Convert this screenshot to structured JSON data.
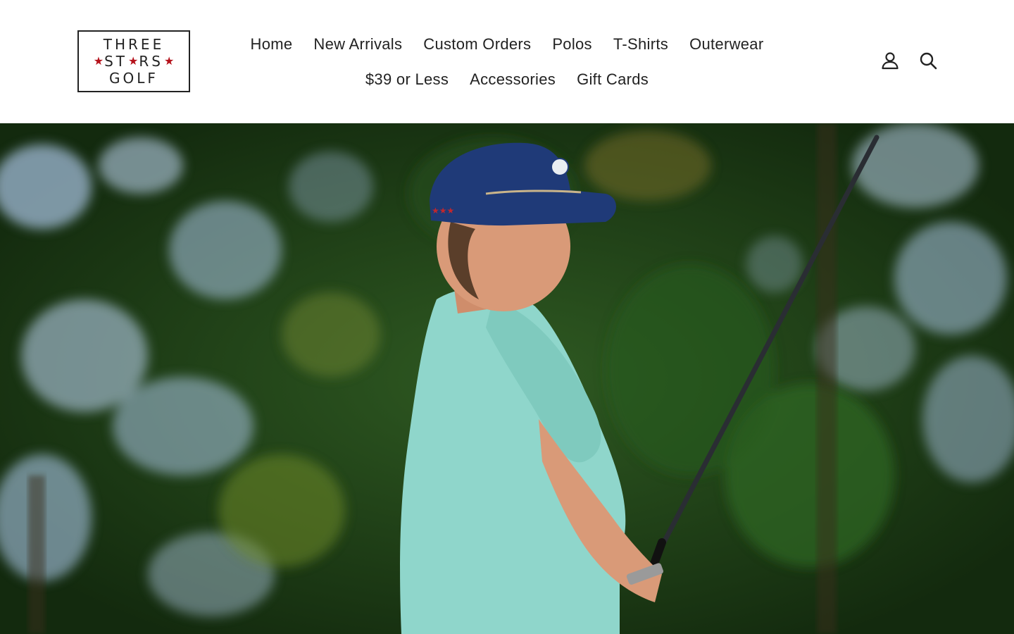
{
  "brand": {
    "logo_line1": "THREE",
    "logo_line2_letters": [
      "S",
      "T",
      "R",
      "S"
    ],
    "logo_line3": "GOLF",
    "star_color": "#b5121b"
  },
  "nav": {
    "items": [
      {
        "label": "Home"
      },
      {
        "label": "New Arrivals"
      },
      {
        "label": "Custom Orders"
      },
      {
        "label": "Polos"
      },
      {
        "label": "T-Shirts"
      },
      {
        "label": "Outerwear"
      },
      {
        "label": "$39 or Less"
      },
      {
        "label": "Accessories"
      },
      {
        "label": "Gift Cards"
      }
    ]
  },
  "header_icons": {
    "account": "user-icon",
    "search": "search-icon"
  },
  "hero": {
    "image": "golfer-hero-photo",
    "colors": {
      "foliage_dark": "#1a3312",
      "foliage_mid": "#2f5a22",
      "sky": "#a9c4e4",
      "cap": "#1f3a78",
      "shirt": "#8fd6cb",
      "skin": "#d99a78"
    }
  }
}
